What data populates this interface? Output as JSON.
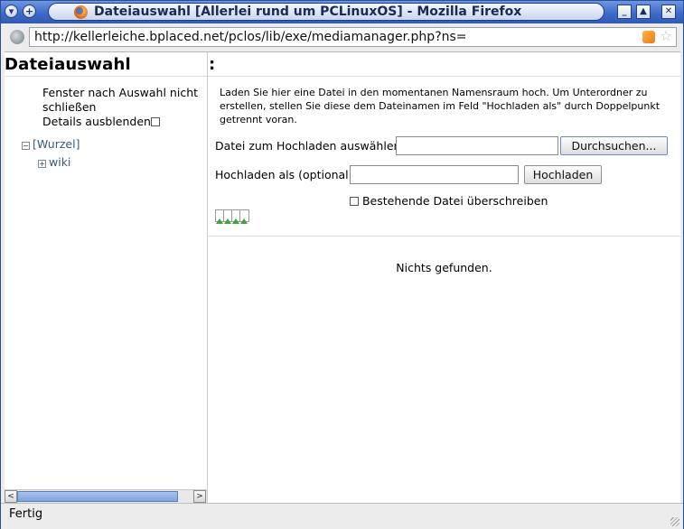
{
  "window": {
    "title": "Dateiauswahl [Allerlei rund um PCLinuxOS] - Mozilla Firefox",
    "controls": {
      "menu": "▾",
      "add": "+",
      "minimize": "_",
      "maximize": "▲",
      "close": "✕"
    }
  },
  "urlbar": {
    "url": "http://kellerleiche.bplaced.net/pclos/lib/exe/mediamanager.php?ns="
  },
  "left": {
    "title": "Dateiauswahl",
    "option_keep_open": "Fenster nach Auswahl nicht schließen",
    "option_hide_details": "Details ausblenden",
    "tree": {
      "root_toggle": "−",
      "root": "[Wurzel]",
      "child_toggle": "+",
      "child": "wiki"
    },
    "scroll": {
      "left": "<",
      "right": ">"
    }
  },
  "right": {
    "title": ":",
    "info": "Laden Sie hier eine Datei in den momentanen Namensraum hoch. Um Unterordner zu erstellen, stellen Sie diese dem Dateinamen im Feld \"Hochladen als\" durch Doppelpunkt getrennt voran.",
    "file_label": "Datei zum Hochladen auswählen:",
    "browse_button": "Durchsuchen...",
    "upload_as_label": "Hochladen als (optional):",
    "upload_button": "Hochladen",
    "overwrite_label": "Bestehende Datei überschreiben",
    "nothing_found": "Nichts gefunden."
  },
  "status": {
    "text": "Fertig"
  },
  "colors": {
    "titlebar": "#3d6bc9",
    "link": "#385a7a",
    "thumb": "#7ea4dd"
  }
}
